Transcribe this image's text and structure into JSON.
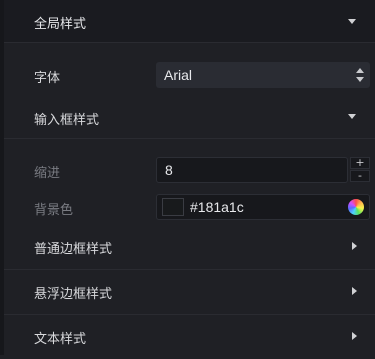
{
  "global_style": {
    "title": "全局样式"
  },
  "font": {
    "label": "字体",
    "value": "Arial"
  },
  "input_box_style": {
    "title": "输入框样式"
  },
  "indent": {
    "label": "缩进",
    "value": "8",
    "plus": "+",
    "minus": "-"
  },
  "background": {
    "label": "背景色",
    "value": "#181a1c"
  },
  "nav": [
    {
      "label": "普通边框样式"
    },
    {
      "label": "悬浮边框样式"
    },
    {
      "label": "文本样式"
    }
  ],
  "colors": {
    "panel_bg": "#1f2025",
    "header_bg": "#1a1b20",
    "input_bg": "#17181c",
    "select_bg": "#2a2c33"
  }
}
